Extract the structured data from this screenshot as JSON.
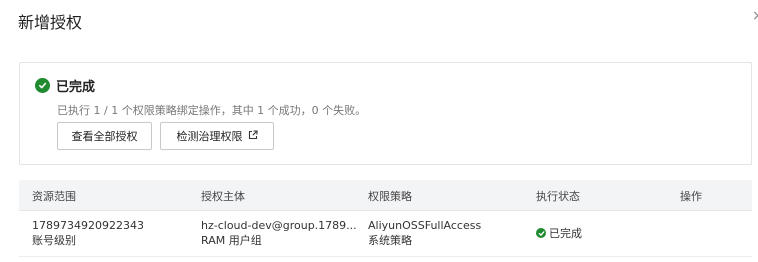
{
  "dialog": {
    "title": "新增授权",
    "close_glyph": "×"
  },
  "result": {
    "status_title": "已完成",
    "description": "已执行 1 / 1 个权限策略绑定操作，其中 1 个成功，0 个失败。",
    "view_all_label": "查看全部授权",
    "check_label": "检测治理权限",
    "status_color": "#1f8a2e"
  },
  "table": {
    "headers": [
      "资源范围",
      "授权主体",
      "权限策略",
      "执行状态",
      "操作"
    ],
    "rows": [
      {
        "scope_id": "1789734920922343",
        "scope_level": "账号级别",
        "principal": "hz-cloud-dev@group.1789...",
        "principal_type": "RAM 用户组",
        "policy": "AliyunOSSFullAccess",
        "policy_type": "系统策略",
        "state": "已完成",
        "action": ""
      }
    ]
  }
}
